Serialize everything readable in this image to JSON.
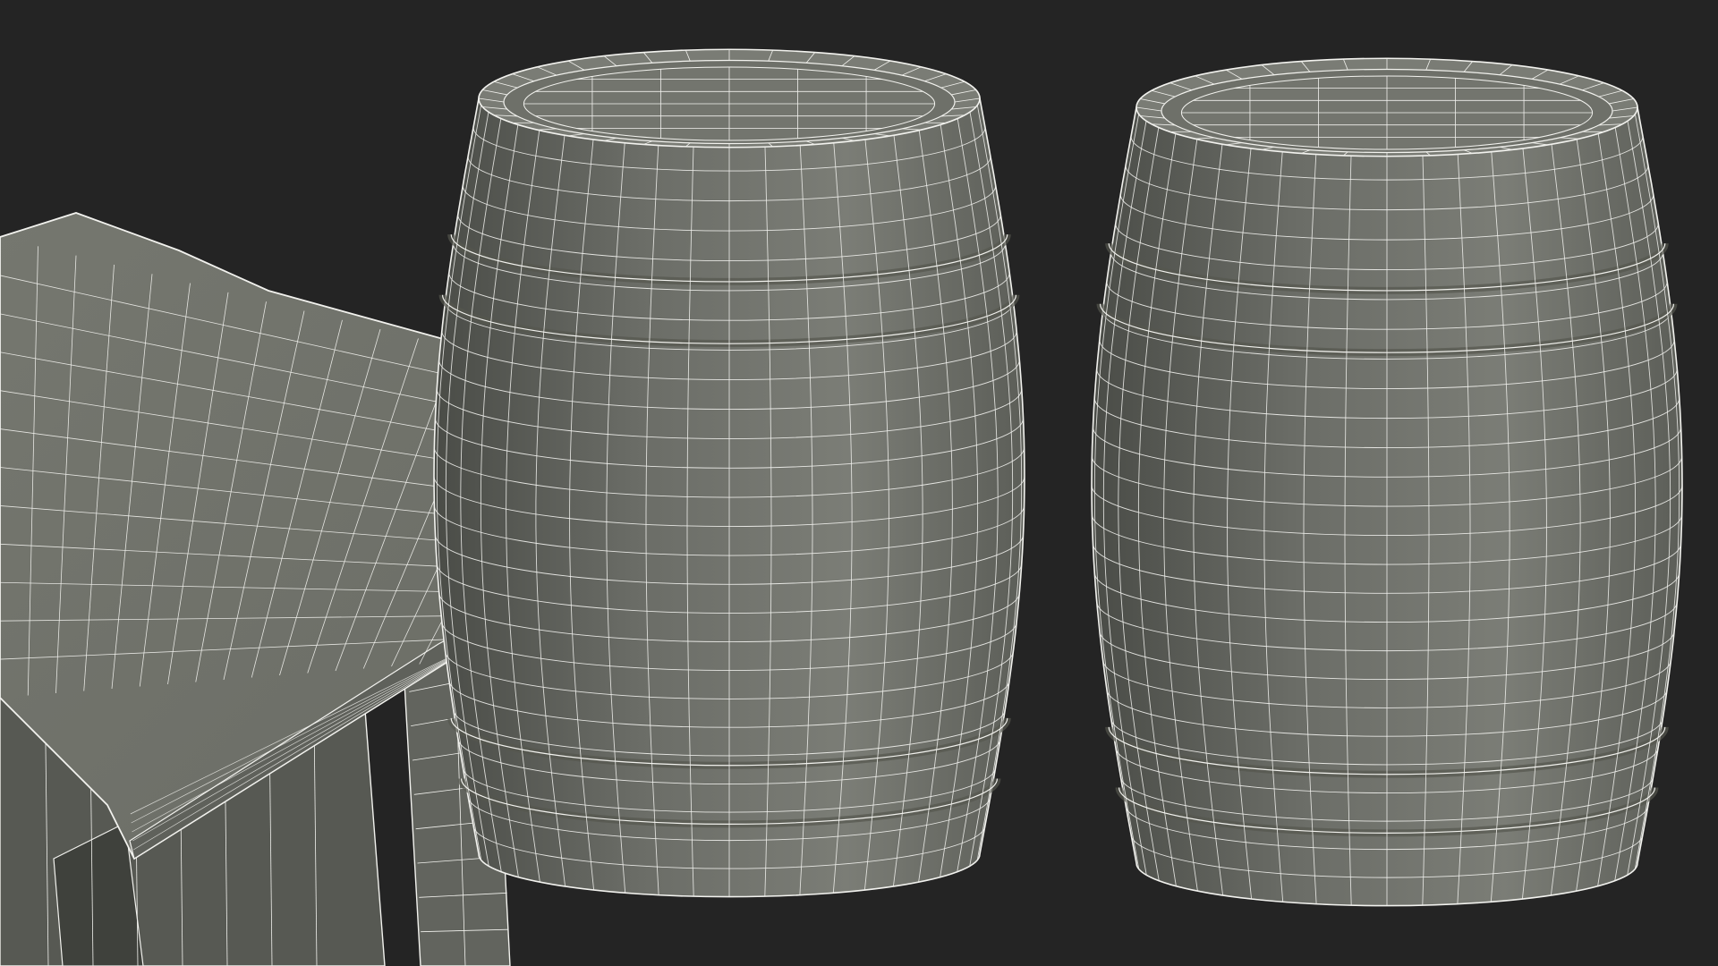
{
  "scene": {
    "background_color": "#242424",
    "mesh_base_color": "#6f716b",
    "mesh_dark_color": "#4c4e49",
    "mesh_light_color": "#8a8c85",
    "wire_color": "#f2f2ee",
    "objects": [
      {
        "name": "wooden-table-wireframe",
        "kind": "table"
      },
      {
        "name": "barrel-left-wireframe",
        "kind": "barrel"
      },
      {
        "name": "barrel-right-wireframe",
        "kind": "barrel"
      }
    ]
  }
}
